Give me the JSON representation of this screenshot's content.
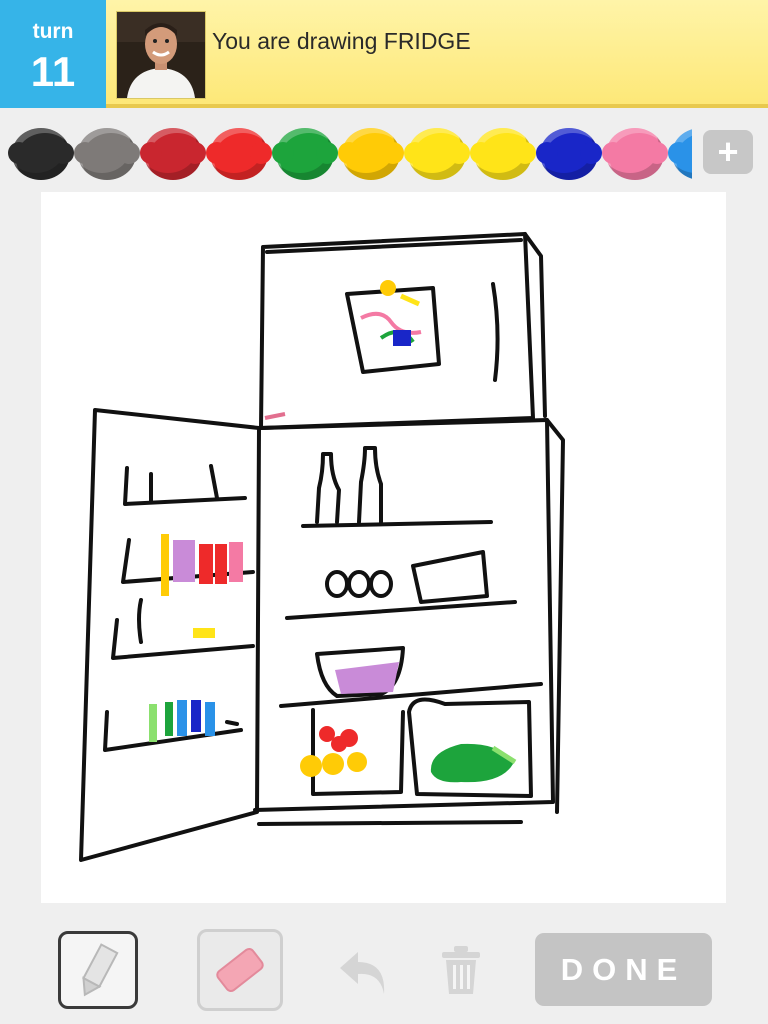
{
  "header": {
    "turn_label": "turn",
    "turn_number": "11",
    "prompt_prefix": "You are drawing",
    "word": "FRIDGE",
    "prompt_text": "You are drawing FRIDGE"
  },
  "palette": {
    "colors": [
      "#2a2a2a",
      "#7e7a78",
      "#c9262f",
      "#ee2a2a",
      "#1da43c",
      "#ffcb06",
      "#ffe418",
      "#ffe418",
      "#1926c8",
      "#f47aa4",
      "#2a92e8"
    ],
    "more_icon": "plus-icon"
  },
  "toolbar": {
    "pencil_icon": "pencil-icon",
    "eraser_icon": "eraser-icon",
    "undo_icon": "undo-icon",
    "trash_icon": "trash-icon",
    "done_label": "DONE"
  },
  "colors": {
    "turn_bg": "#36b4e8",
    "header_bg": "#fde878",
    "done_bg": "#c4c4c4"
  }
}
